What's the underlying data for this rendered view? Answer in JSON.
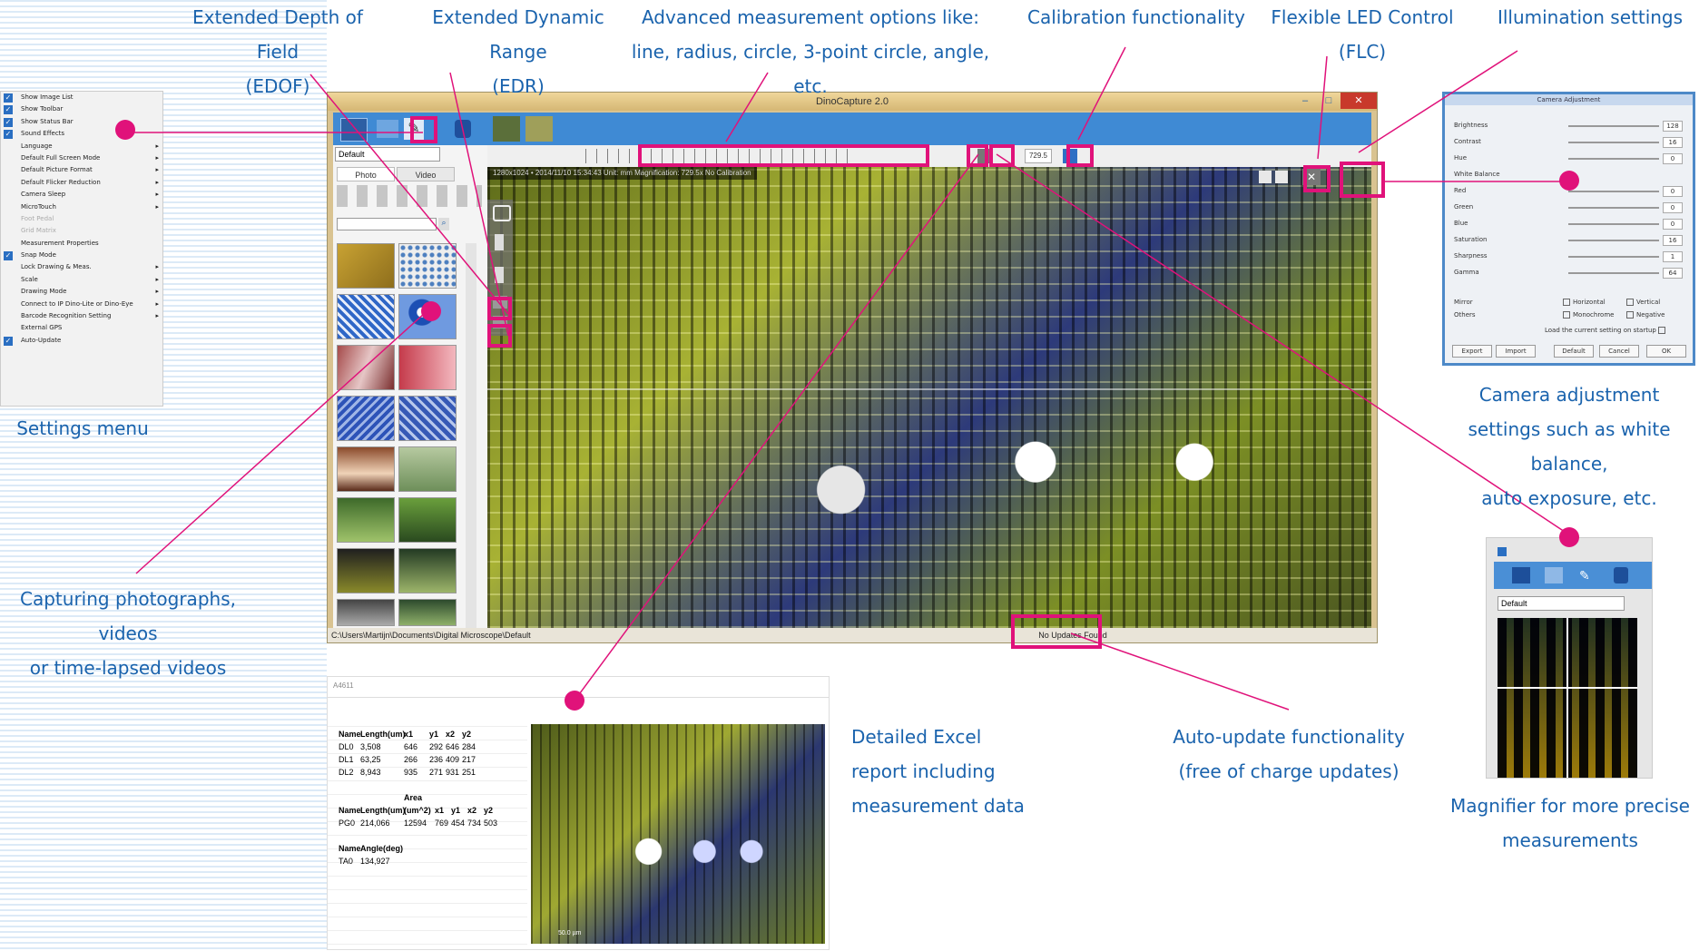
{
  "captions": {
    "edof": [
      "Extended Depth of Field",
      "(EDOF)"
    ],
    "edr": [
      "Extended Dynamic Range",
      "(EDR)"
    ],
    "measurement": [
      "Advanced measurement options like:",
      "line, radius, circle, 3-point circle, angle, etc."
    ],
    "calibration": "Calibration functionality",
    "flc": "Flexible LED Control (FLC)",
    "illumination": "Illumination settings",
    "settings_menu": "Settings menu",
    "capturing": [
      "Capturing photographs, videos",
      "or time-lapsed videos"
    ],
    "camera_adjust": [
      "Camera adjustment",
      "settings such as white balance,",
      "auto exposure, etc."
    ],
    "magnifier": [
      "Magnifier for more precise",
      "measurements"
    ],
    "excel": [
      "Detailed Excel",
      "report including",
      "measurement data"
    ],
    "autoupdate": [
      "Auto-update functionality",
      "(free of charge updates)"
    ]
  },
  "settings_menu_items": [
    {
      "label": "Show Image List",
      "checked": true
    },
    {
      "label": "Show Toolbar",
      "checked": true
    },
    {
      "label": "Show Status Bar",
      "checked": true
    },
    {
      "label": "Sound Effects",
      "checked": true
    },
    {
      "label": "Language",
      "sub": true
    },
    {
      "label": "Default Full Screen Mode",
      "sub": true
    },
    {
      "label": "Default Picture Format",
      "sub": true
    },
    {
      "label": "Default Flicker Reduction",
      "sub": true
    },
    {
      "label": "Camera Sleep",
      "sub": true
    },
    {
      "label": "MicroTouch",
      "sub": true
    },
    {
      "label": "Foot Pedal",
      "disabled": true
    },
    {
      "label": "Grid Matrix",
      "disabled": true
    },
    {
      "label": "Measurement Properties"
    },
    {
      "label": "Snap Mode",
      "checked": true
    },
    {
      "label": "Lock Drawing & Meas.",
      "sub": true
    },
    {
      "label": "Scale",
      "sub": true
    },
    {
      "label": "Drawing Mode",
      "sub": true
    },
    {
      "label": "Connect to IP Dino-Lite or Dino-Eye",
      "sub": true
    },
    {
      "label": "Barcode Recognition Setting",
      "sub": true
    },
    {
      "label": "External GPS"
    },
    {
      "label": "Auto-Update",
      "checked": true
    }
  ],
  "window": {
    "title": "DinoCapture 2.0",
    "profile": "Default",
    "tabs": [
      "Photo",
      "Video"
    ],
    "infobar": "1280x1024 • 2014/11/10 15:34:43   Unit: mm   Magnification: 729.5x   No Calibration",
    "magnification": "729.5",
    "status_path": "C:\\Users\\Martijn\\Documents\\Digital Microscope\\Default",
    "status_update": "No Updates Found"
  },
  "camera_adjustment": {
    "title": "Camera Adjustment",
    "rows": [
      {
        "label": "Brightness",
        "value": "128"
      },
      {
        "label": "Contrast",
        "value": "16"
      },
      {
        "label": "Hue",
        "value": "0"
      },
      {
        "label": "White Balance",
        "value": ""
      },
      {
        "label": "Red",
        "value": "0"
      },
      {
        "label": "Green",
        "value": "0"
      },
      {
        "label": "Blue",
        "value": "0"
      },
      {
        "label": "Saturation",
        "value": "16"
      },
      {
        "label": "Sharpness",
        "value": "1"
      },
      {
        "label": "Gamma",
        "value": "64"
      }
    ],
    "mirror_label": "Mirror",
    "mirror_opts": [
      "Horizontal",
      "Vertical"
    ],
    "others_label": "Others",
    "others_opts": [
      "Monochrome",
      "Negative"
    ],
    "load_startup": "Load the current setting on startup",
    "buttons": [
      "Export",
      "Import",
      "Default",
      "Cancel",
      "OK"
    ]
  },
  "magnifier": {
    "profile": "Default"
  },
  "excel": {
    "cell_ref": "A4611",
    "table1_headers": [
      "Name",
      "Length(um)",
      "x1",
      "y1",
      "x2",
      "y2"
    ],
    "table1_rows": [
      [
        "DL0",
        "3,508",
        "646",
        "292",
        "646",
        "284"
      ],
      [
        "DL1",
        "63,25",
        "266",
        "236",
        "409",
        "217"
      ],
      [
        "DL2",
        "8,943",
        "935",
        "271",
        "931",
        "251"
      ]
    ],
    "table2_area": "Area",
    "table2_headers": [
      "Name",
      "Length(um)",
      "(um^2)",
      "x1",
      "y1",
      "x2",
      "y2"
    ],
    "table2_row": [
      "PG0",
      "214,066",
      "12594",
      "769",
      "454",
      "734",
      "503"
    ],
    "table3_headers": [
      "Name",
      "Angle(deg)"
    ],
    "table3_row": [
      "TA0",
      "134,927"
    ],
    "scale_label": "50.0 µm"
  },
  "colors": {
    "accent": "#e0127a",
    "caption": "#1a63ad"
  }
}
